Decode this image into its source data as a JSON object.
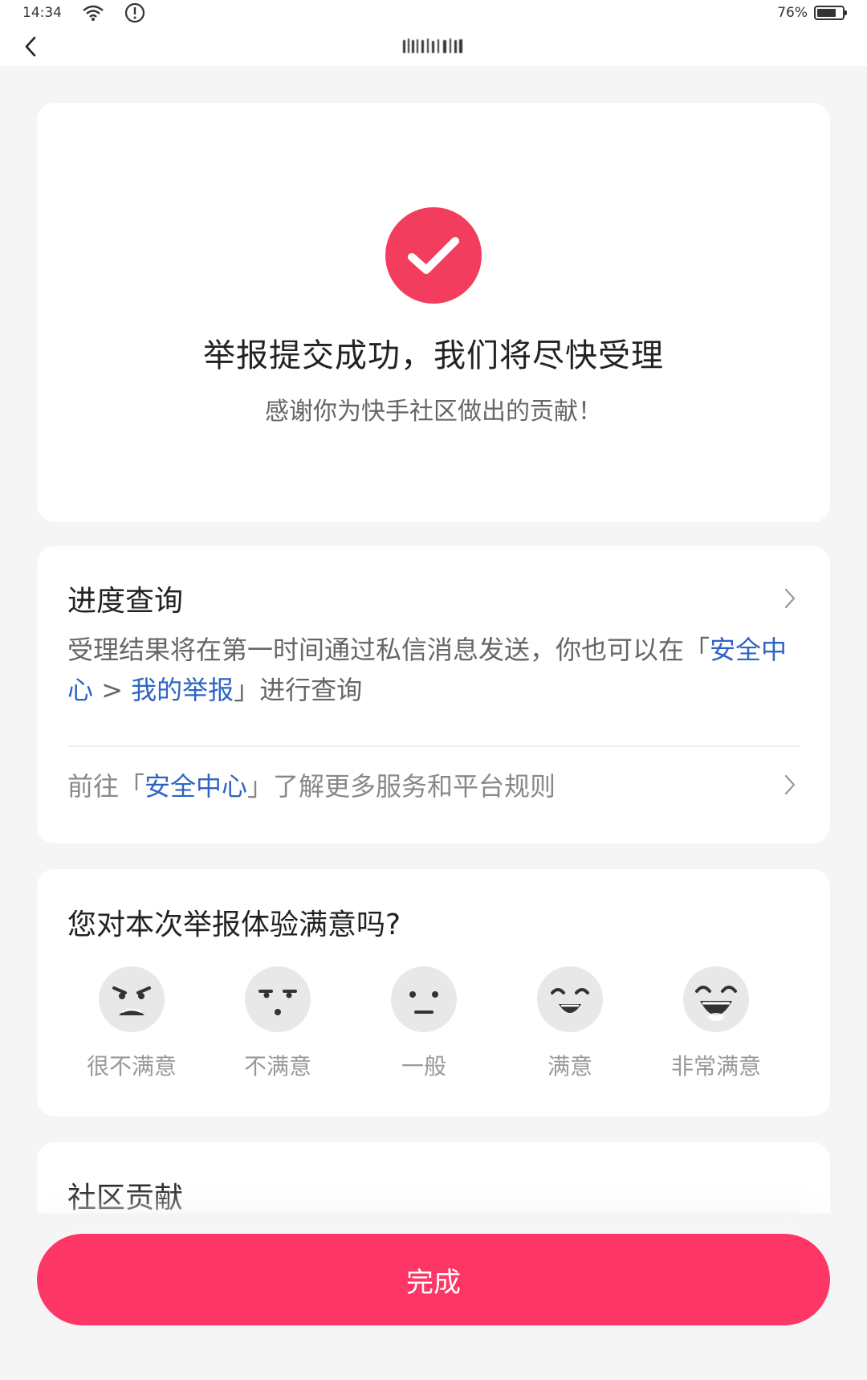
{
  "status_bar": {
    "time": "14:34",
    "battery": "76%",
    "battery_level": 0.76,
    "icons": [
      "wifi-icon",
      "alert-icon",
      "battery-icon"
    ]
  },
  "nav": {
    "back_icon": "chevron-left-icon"
  },
  "success": {
    "icon": "check-circle-icon",
    "title": "举报提交成功，我们将尽快受理",
    "subtitle": "感谢你为快手社区做出的贡献！"
  },
  "progress": {
    "title": "进度查询",
    "desc_part1": "受理结果将在第一时间通过私信消息发送，你也可以在「",
    "link1": "安全中心",
    "sep": " > ",
    "link2": "我的举报",
    "desc_part2": "」进行查询",
    "goto_prefix": "前往「",
    "goto_link": "安全中心",
    "goto_suffix": "」了解更多服务和平台规则"
  },
  "satisfaction": {
    "title": "您对本次举报体验满意吗?",
    "options": [
      {
        "label": "很不满意",
        "icon": "very-dissatisfied-face-icon"
      },
      {
        "label": "不满意",
        "icon": "dissatisfied-face-icon"
      },
      {
        "label": "一般",
        "icon": "neutral-face-icon"
      },
      {
        "label": "满意",
        "icon": "satisfied-face-icon"
      },
      {
        "label": "非常满意",
        "icon": "very-satisfied-face-icon"
      }
    ]
  },
  "community": {
    "title": "社区贡献"
  },
  "done_button": "完成",
  "colors": {
    "accent": "#f33d5f",
    "button": "#fe3666",
    "link": "#2f63c5"
  }
}
